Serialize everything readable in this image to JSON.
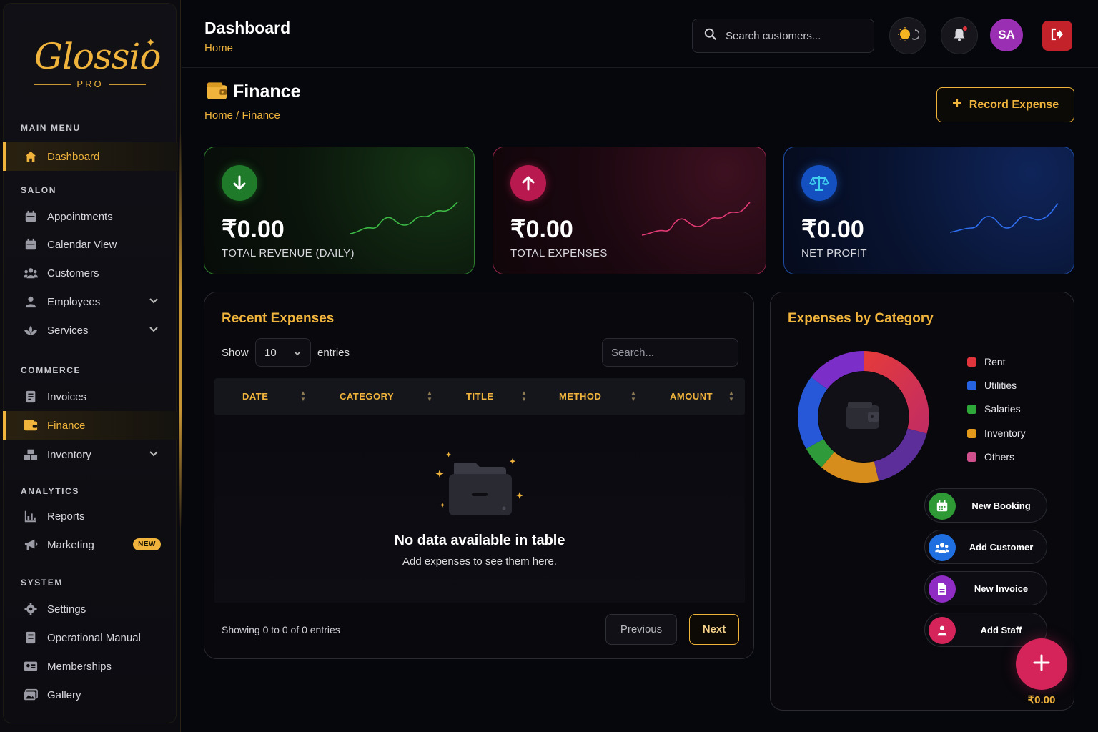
{
  "brand": {
    "name": "Glossio",
    "sub": "PRO"
  },
  "sidebar": {
    "sections": {
      "main": "MAIN MENU",
      "salon": "SALON",
      "commerce": "COMMERCE",
      "analytics": "ANALYTICS",
      "system": "SYSTEM"
    },
    "items": {
      "dashboard": "Dashboard",
      "appointments": "Appointments",
      "calendar": "Calendar View",
      "customers": "Customers",
      "employees": "Employees",
      "services": "Services",
      "invoices": "Invoices",
      "finance": "Finance",
      "inventory": "Inventory",
      "reports": "Reports",
      "marketing": "Marketing",
      "marketing_badge": "NEW",
      "settings": "Settings",
      "manual": "Operational Manual",
      "memberships": "Memberships",
      "gallery": "Gallery"
    }
  },
  "header": {
    "title": "Dashboard",
    "breadcrumb": "Home",
    "search_placeholder": "Search customers...",
    "avatar": "SA"
  },
  "page": {
    "title": "Finance",
    "breadcrumb": "Home / Finance",
    "record_button": "Record Expense"
  },
  "stats": [
    {
      "value": "₹0.00",
      "label": "TOTAL REVENUE (DAILY)",
      "icon": "arrow-down-icon",
      "color": "#2fa83a"
    },
    {
      "value": "₹0.00",
      "label": "TOTAL EXPENSES",
      "icon": "arrow-up-icon",
      "color": "#d9235e"
    },
    {
      "value": "₹0.00",
      "label": "NET PROFIT",
      "icon": "scale-icon",
      "color": "#1f62d8"
    }
  ],
  "expenses": {
    "title": "Recent Expenses",
    "show_label": "Show",
    "page_size": "10",
    "entries_label": "entries",
    "search_placeholder": "Search...",
    "columns": [
      "DATE",
      "CATEGORY",
      "TITLE",
      "METHOD",
      "AMOUNT"
    ],
    "empty_title": "No data available in table",
    "empty_sub": "Add expenses to see them here.",
    "showing": "Showing 0 to 0 of 0 entries",
    "prev": "Previous",
    "next": "Next"
  },
  "categories": {
    "title": "Expenses by Category",
    "legend": [
      {
        "name": "Rent",
        "color": "#e0353c"
      },
      {
        "name": "Utilities",
        "color": "#2563e0"
      },
      {
        "name": "Salaries",
        "color": "#2fa83a"
      },
      {
        "name": "Inventory",
        "color": "#e39a1c"
      },
      {
        "name": "Others",
        "color": "#d0508e"
      }
    ]
  },
  "quick_actions": [
    {
      "label": "New Booking",
      "color": "#2f9a35",
      "icon": "calendar-icon"
    },
    {
      "label": "Add Customer",
      "color": "#1f6fe0",
      "icon": "users-icon"
    },
    {
      "label": "New Invoice",
      "color": "#8e2cc4",
      "icon": "document-icon"
    },
    {
      "label": "Add Staff",
      "color": "#d4245a",
      "icon": "user-icon"
    }
  ],
  "fab_total": "₹0.00"
}
